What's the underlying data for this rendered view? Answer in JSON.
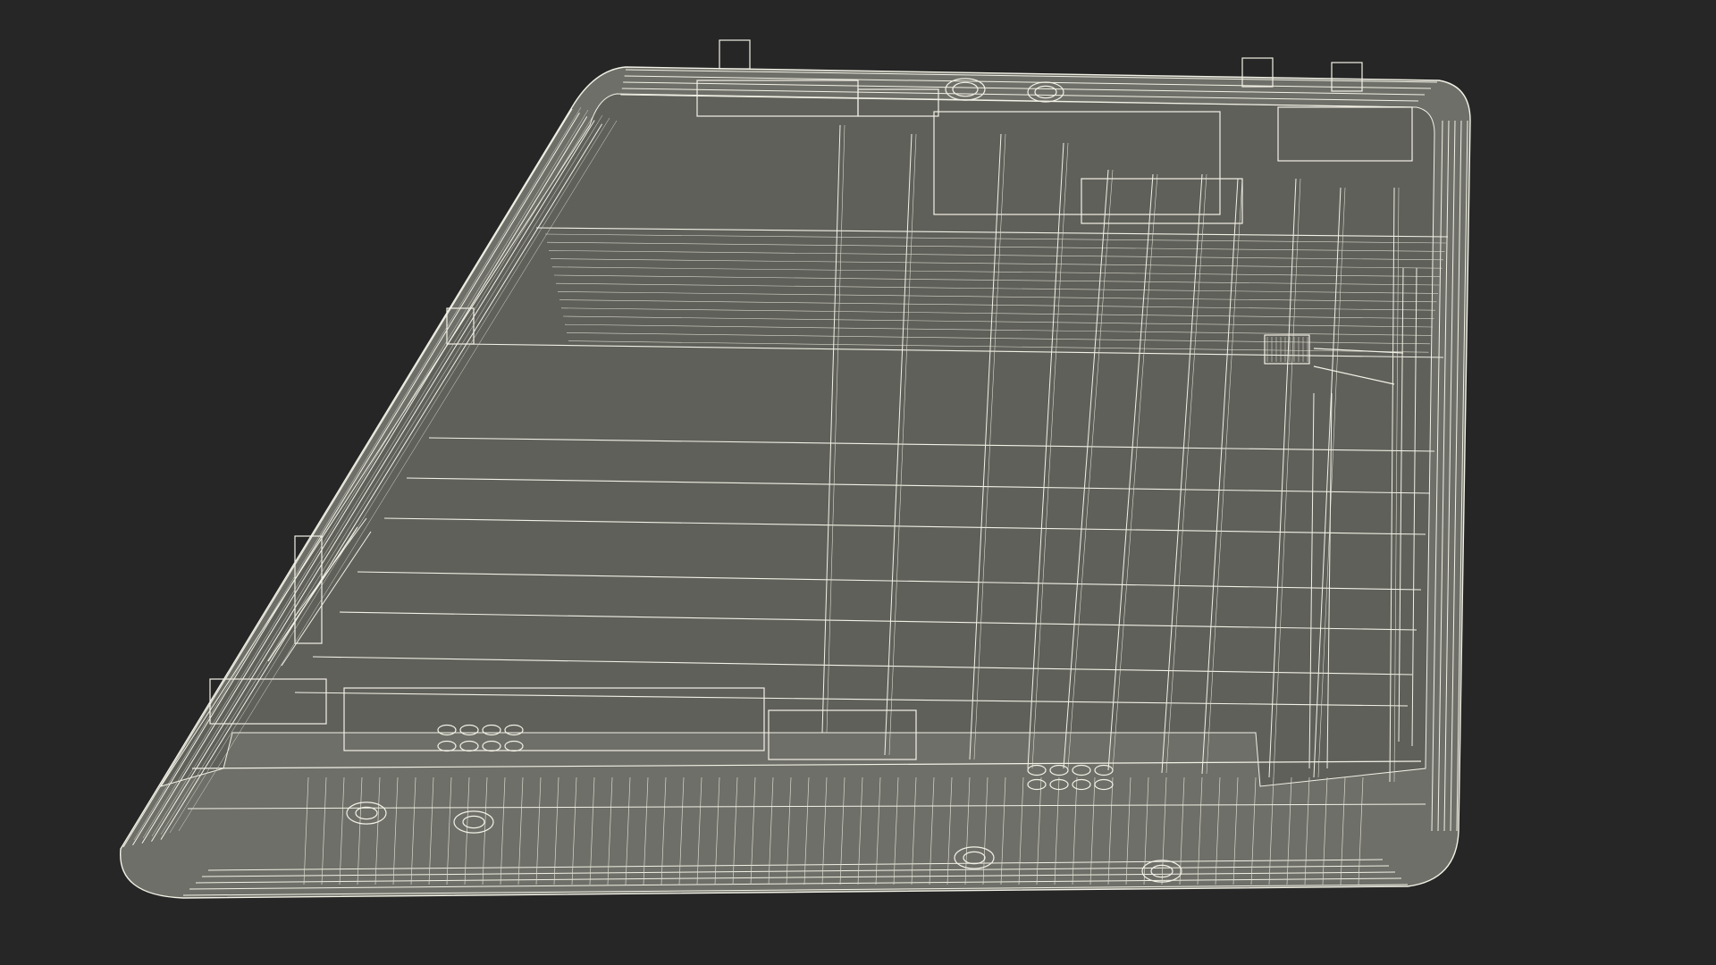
{
  "scene": {
    "subject": "tablet-back-shell-wireframe",
    "colors": {
      "background": "#262626",
      "surface": "#6e6f68",
      "surface_dark": "#5f605a",
      "wire": "#f2f1e6",
      "wire_soft": "#d9d8cc"
    }
  }
}
